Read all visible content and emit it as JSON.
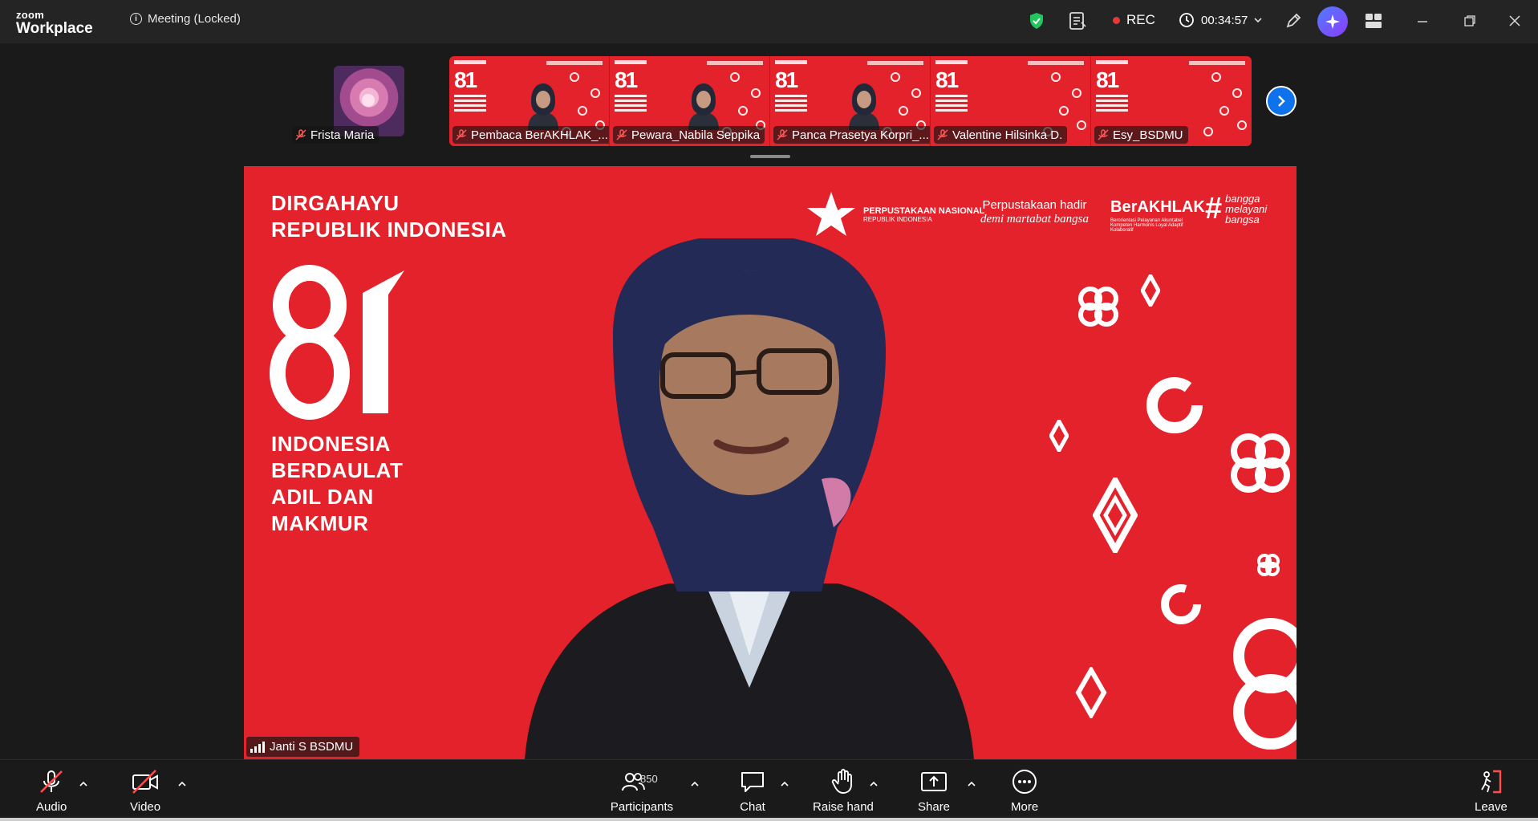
{
  "app": {
    "brand_top": "zoom",
    "brand_bottom": "Workplace",
    "meeting_title": "Meeting (Locked)"
  },
  "header": {
    "rec_label": "REC",
    "timer": "00:34:57"
  },
  "thumbnails": {
    "solo": {
      "name": "Frista Maria"
    },
    "strip": [
      {
        "name": "Pembaca BerAKHLAK_...",
        "has_person": true
      },
      {
        "name": "Pewara_Nabila Seppika",
        "has_person": true
      },
      {
        "name": "Panca Prasetya Korpri_...",
        "has_person": true
      },
      {
        "name": "Valentine Hilsinka D.",
        "has_person": false
      },
      {
        "name": "Esy_BSDMU",
        "has_person": false
      }
    ]
  },
  "main_video": {
    "title_line1": "DIRGAHAYU",
    "title_line2": "REPUBLIK INDONESIA",
    "tagline": [
      "INDONESIA",
      "BERDAULAT",
      "ADIL DAN",
      "MAKMUR"
    ],
    "logo_perpus_line1": "PERPUSTAKAAN NASIONAL",
    "logo_perpus_line2": "REPUBLIK INDONESIA",
    "logo_hadir_line1": "Perpustakaan hadir",
    "logo_hadir_line2": "demi martabat bangsa",
    "logo_berakhlak": "BerAKHLAK",
    "logo_berakhlak_sub": "Berorientasi Pelayanan Akuntabel Kompeten Harmonis Loyal Adaptif Kolaboratif",
    "logo_bangga": [
      "bangga",
      "melayani",
      "bangsa"
    ],
    "speaker_name": "Janti S BSDMU"
  },
  "toolbar": {
    "audio_label": "Audio",
    "video_label": "Video",
    "participants_label": "Participants",
    "participants_count": "850",
    "chat_label": "Chat",
    "raise_hand_label": "Raise hand",
    "share_label": "Share",
    "more_label": "More",
    "leave_label": "Leave"
  },
  "colors": {
    "banner_red": "#e4222b",
    "accent_blue": "#0e72ed",
    "rec_red": "#e23a3a",
    "shield_green": "#22c55e"
  }
}
